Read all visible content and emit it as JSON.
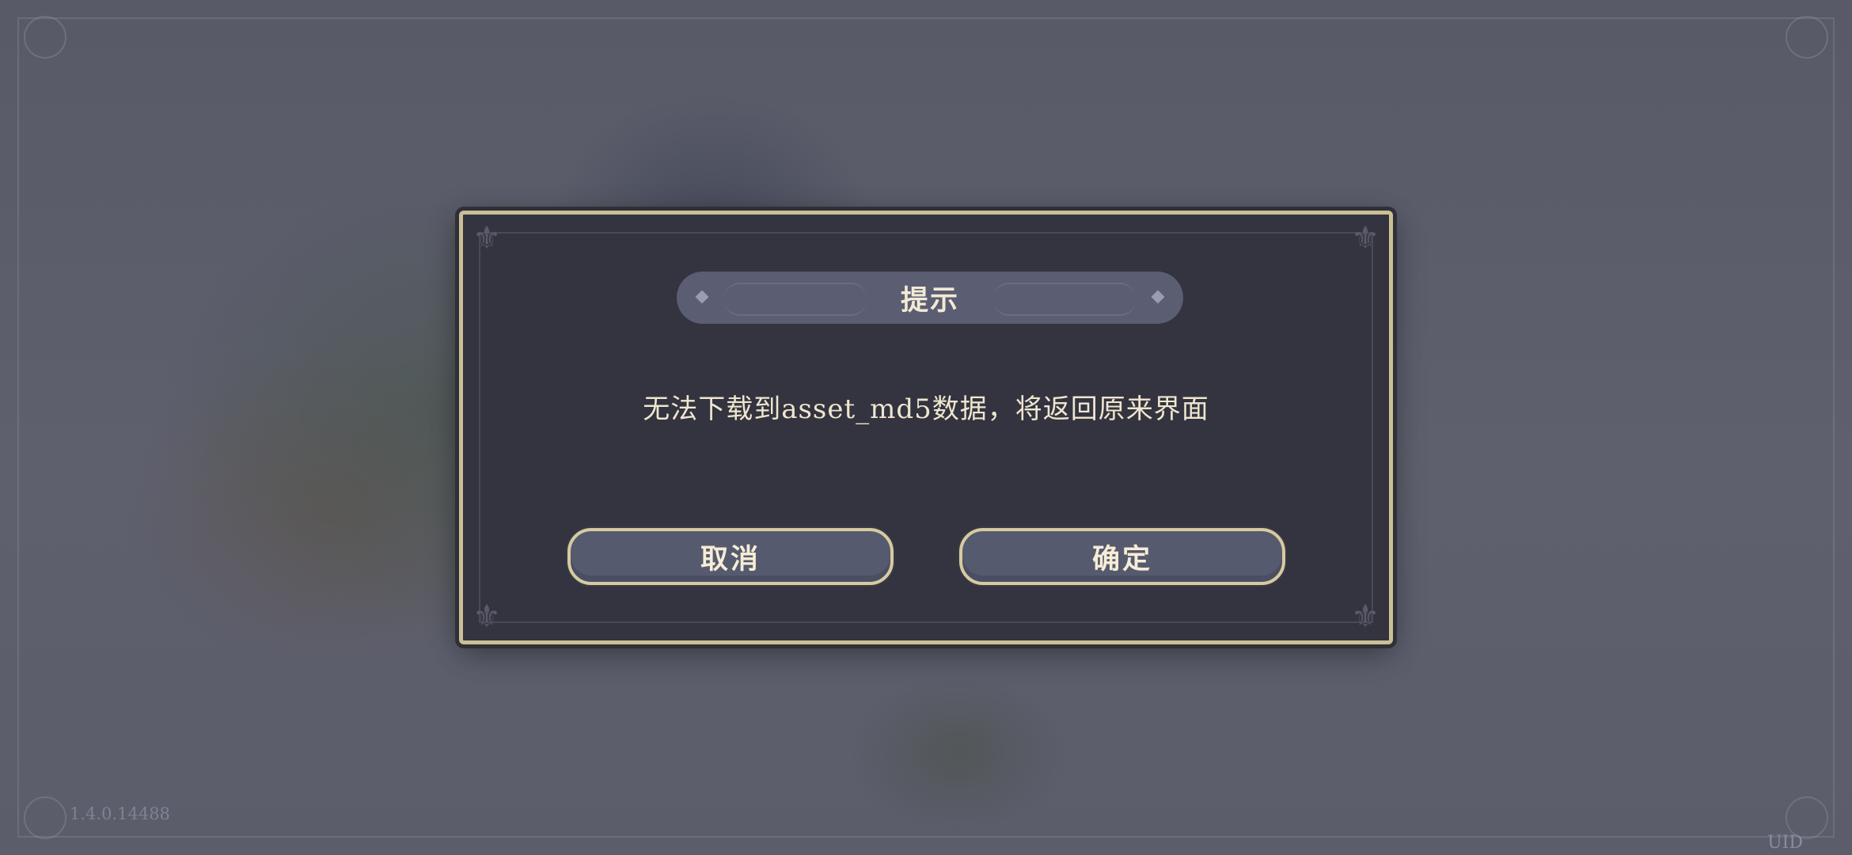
{
  "dialog": {
    "title": "提示",
    "message": "无法下载到asset_md5数据，将返回原来界面",
    "cancel_label": "取消",
    "confirm_label": "确定"
  },
  "footer": {
    "version": "1.4.0.14488",
    "uid_label": "UID"
  },
  "colors": {
    "frame_gold": "#cbbf96",
    "dialog_bg": "#33343f",
    "button_bg": "#565a6e",
    "text_cream": "#efe6cf"
  },
  "icons": {
    "corner_ornament": "fleur-de-lis-icon"
  }
}
